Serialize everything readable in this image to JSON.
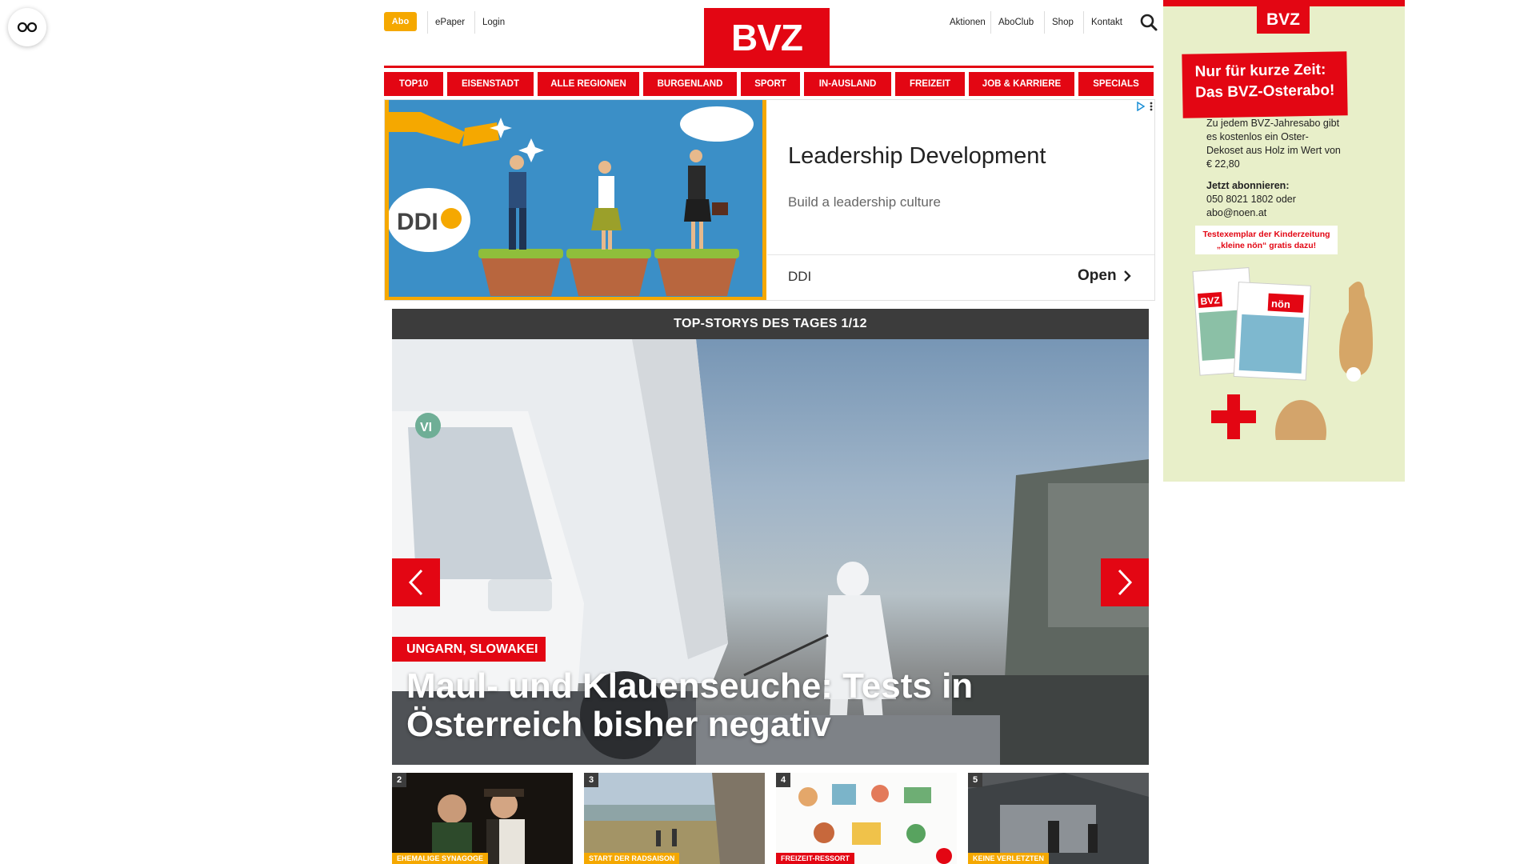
{
  "header": {
    "abo_label": "Abo",
    "left_links": [
      "ePaper",
      "Login"
    ],
    "logo_text": "BVZ",
    "right_links": [
      "Aktionen",
      "AboClub",
      "Shop",
      "Kontakt"
    ]
  },
  "nav": {
    "items": [
      "TOP10",
      "EISENSTADT",
      "ALLE REGIONEN",
      "BURGENLAND",
      "SPORT",
      "IN-AUSLAND",
      "FREIZEIT",
      "JOB & KARRIERE",
      "SPECIALS"
    ]
  },
  "ad_banner": {
    "brand_logo": "DDI",
    "title": "Leadership Development",
    "subtitle": "Build a leadership culture",
    "brand": "DDI",
    "cta": "Open"
  },
  "slider": {
    "heading": "TOP-STORYS DES TAGES 1/12",
    "tag": "UNGARN, SLOWAKEI",
    "title": "Maul- und Klauenseuche: Tests in Österreich bisher negativ",
    "truck_text": "VI"
  },
  "thumbnails": [
    {
      "num": "2",
      "tag": "EHEMALIGE SYNAGOGE"
    },
    {
      "num": "3",
      "tag": "START DER RADSAISON"
    },
    {
      "num": "4",
      "tag": "FREIZEIT-RESSORT"
    },
    {
      "num": "5",
      "tag": "KEINE VERLETZTEN"
    }
  ],
  "side_ad": {
    "logo": "BVZ",
    "headline_1": "Nur für kurze Zeit:",
    "headline_2": "Das BVZ-Osterabo!",
    "body": "Zu jedem BVZ-Jahresabo gibt es kostenlos ein Oster-Dekoset aus Holz im Wert von € 22,80",
    "subscribe_label": "Jetzt abonnieren:",
    "phone": "050 8021 1802 oder",
    "email": "abo@noen.at",
    "note": "Testexemplar der Kinderzeitung „kleine nön“ gratis dazu!",
    "paper_brand": "BVZ",
    "kids_brand": "nön"
  },
  "colors": {
    "brand_red": "#e30613",
    "abo_orange": "#f5a800",
    "dark_header": "#3c3c3c"
  }
}
